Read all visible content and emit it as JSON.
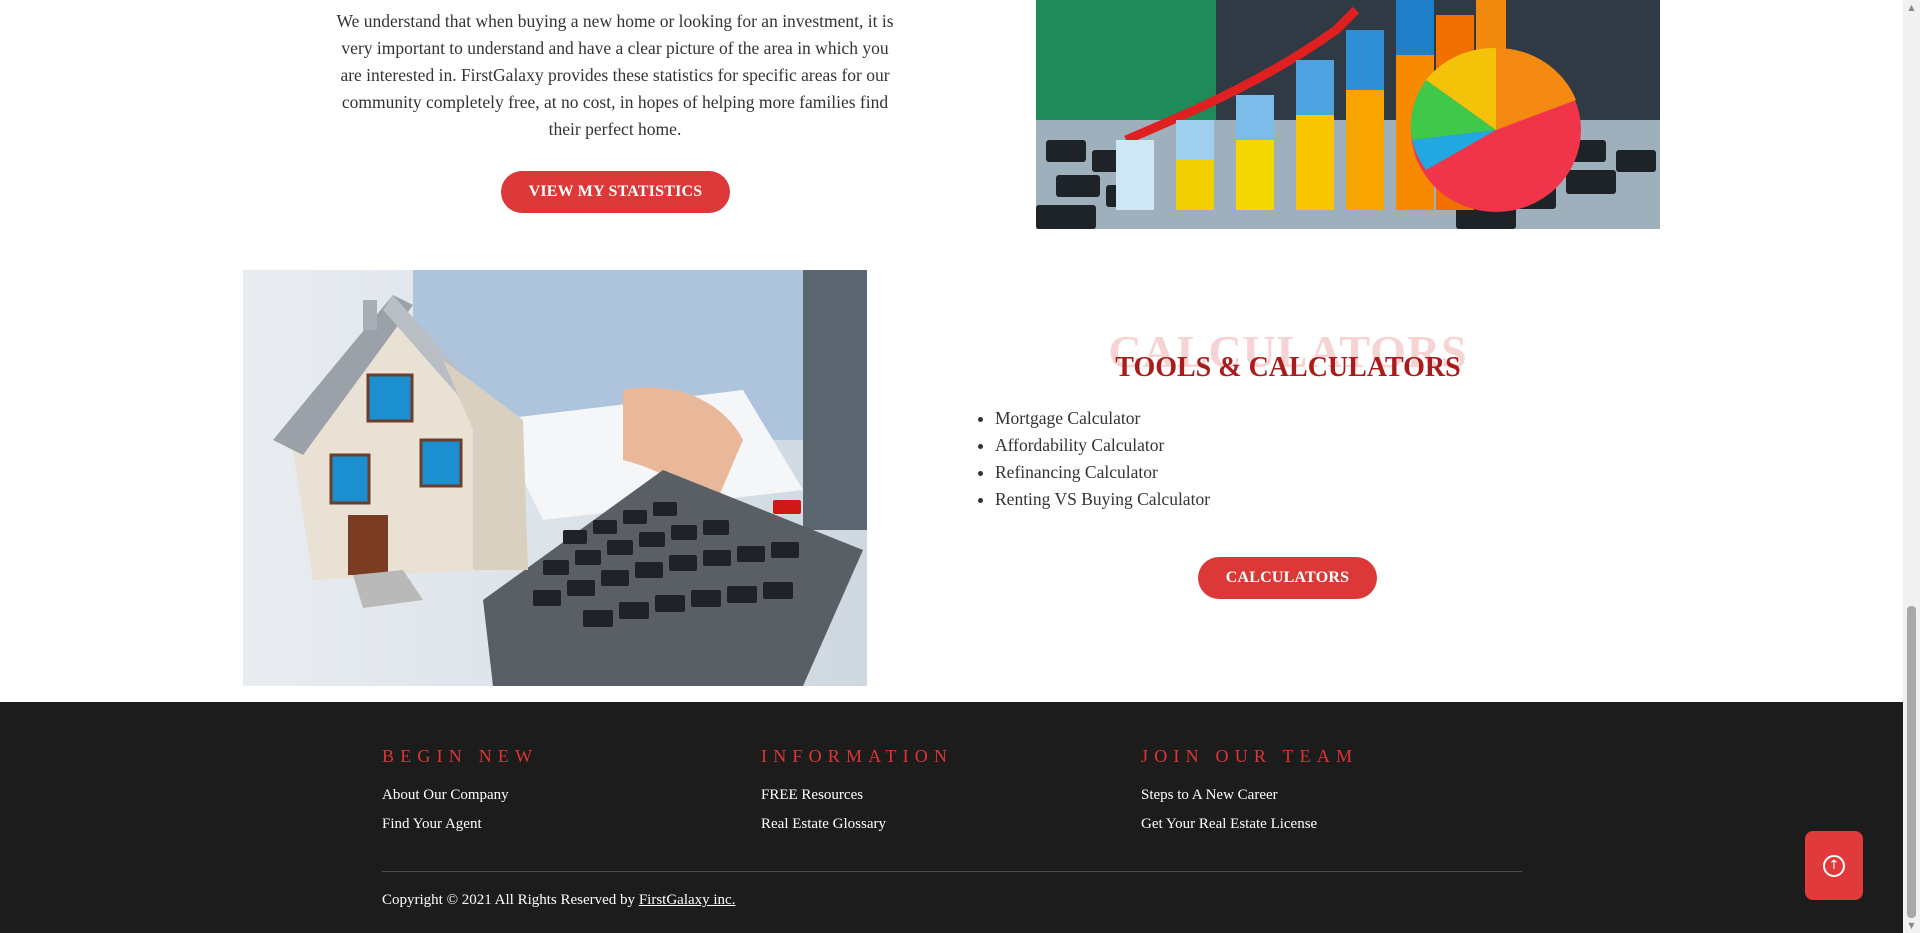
{
  "stats": {
    "paragraph": "We understand that when buying a new home or looking for an investment, it is very important to understand and have a clear picture of the area in which you are interested in. FirstGalaxy provides these statistics for specific areas for our community completely free, at no cost, in hopes of helping more families find their perfect home.",
    "button_label": "VIEW MY STATISTICS"
  },
  "tools": {
    "ghost_title": "CALCULATORS",
    "title": "TOOLS & CALCULATORS",
    "items": [
      "Mortgage Calculator",
      "Affordability Calculator",
      "Refinancing Calculator",
      "Renting VS Buying Calculator"
    ],
    "button_label": "CALCULATORS"
  },
  "footer": {
    "columns": [
      {
        "heading": "BEGIN NEW",
        "links": [
          "About Our Company",
          "Find Your Agent"
        ]
      },
      {
        "heading": "INFORMATION",
        "links": [
          "FREE Resources",
          "Real Estate Glossary"
        ]
      },
      {
        "heading": "JOIN OUR TEAM",
        "links": [
          "Steps to A New Career",
          "Get Your Real Estate License"
        ]
      }
    ],
    "copyright_text": "Copyright © 2021 All Rights Reserved by ",
    "copyright_link": "FirstGalaxy inc."
  },
  "colors": {
    "accent_red": "#dc3838",
    "title_red": "#a81c1c",
    "footer_bg": "#1c1c1c"
  },
  "icons": {
    "back_to_top": "arrow-up-circle-icon"
  }
}
